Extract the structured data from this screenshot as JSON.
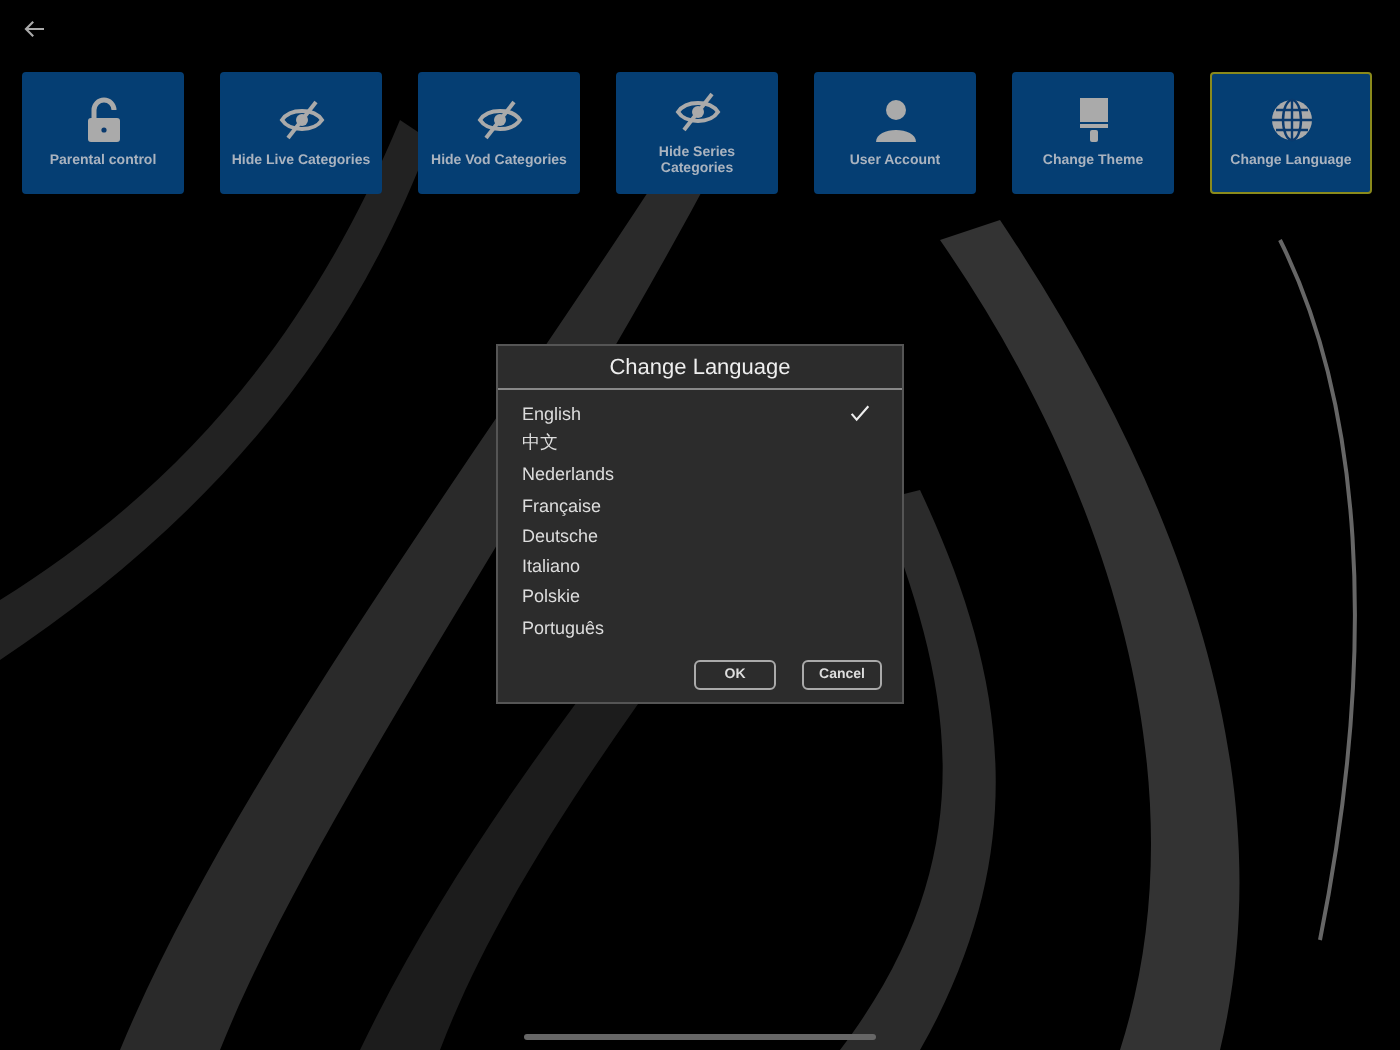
{
  "tiles": [
    {
      "kind": "lock",
      "label": "Parental control",
      "selected": false
    },
    {
      "kind": "eye-slash",
      "label": "Hide Live Categories",
      "selected": false
    },
    {
      "kind": "eye-slash",
      "label": "Hide Vod Categories",
      "selected": false
    },
    {
      "kind": "eye-slash",
      "label": "Hide Series Categories",
      "selected": false
    },
    {
      "kind": "user",
      "label": "User Account",
      "selected": false
    },
    {
      "kind": "brush",
      "label": "Change Theme",
      "selected": false
    },
    {
      "kind": "globe",
      "label": "Change Language",
      "selected": true
    }
  ],
  "dialog": {
    "title": "Change Language",
    "options": [
      {
        "label": "English",
        "selected": true
      },
      {
        "label": "中文",
        "selected": false
      },
      {
        "label": "Nederlands",
        "selected": false
      },
      {
        "label": "Française",
        "selected": false
      },
      {
        "label": "Deutsche",
        "selected": false
      },
      {
        "label": "Italiano",
        "selected": false
      },
      {
        "label": "Polskie",
        "selected": false
      },
      {
        "label": "Português",
        "selected": false
      }
    ],
    "buttons": [
      "OK",
      "Cancel"
    ]
  }
}
